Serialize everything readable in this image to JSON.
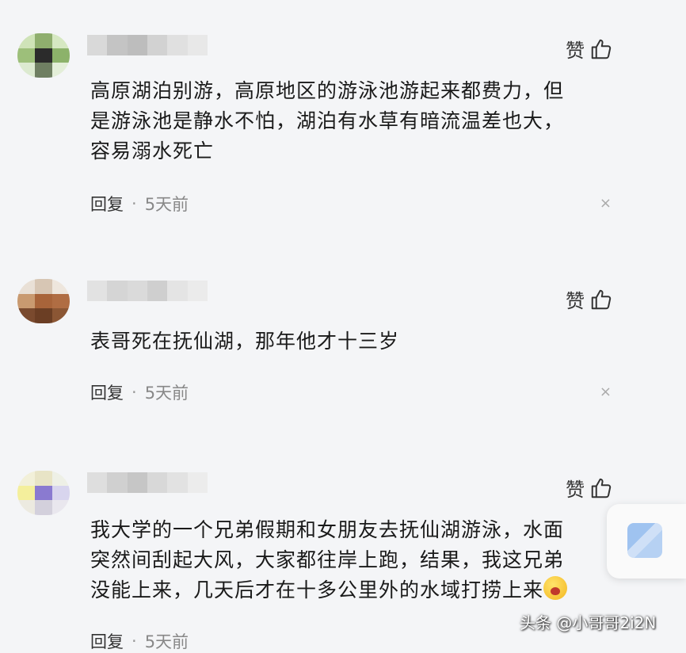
{
  "comments": [
    {
      "like_label": "赞",
      "text_lines": [
        "高原湖泊别游，高原地区的游泳池游起来都费力，但",
        "是游泳池是静水不怕，湖泊有水草有暗流温差也大，",
        "容易溺水死亡"
      ],
      "reply_label": "回复",
      "dot": "·",
      "time": "5天前",
      "close": "×"
    },
    {
      "like_label": "赞",
      "text_lines": [
        "表哥死在抚仙湖，那年他才十三岁"
      ],
      "reply_label": "回复",
      "dot": "·",
      "time": "5天前",
      "close": "×"
    },
    {
      "like_label": "赞",
      "text_lines": [
        "我大学的一个兄弟假期和女朋友去抚仙湖游泳，水面",
        "突然间刮起大风，大家都往岸上跑，结果，我这兄弟",
        "没能上来，几天后才在十多公里外的水域打捞上来"
      ],
      "reply_label": "回复",
      "dot": "·",
      "time": "5天前",
      "close": "×"
    }
  ],
  "watermark": "头条 @小哥哥2i2N",
  "icons": {
    "like": "thumbs-up-icon",
    "close": "close-icon",
    "emoji": "crying-face-emoji"
  }
}
